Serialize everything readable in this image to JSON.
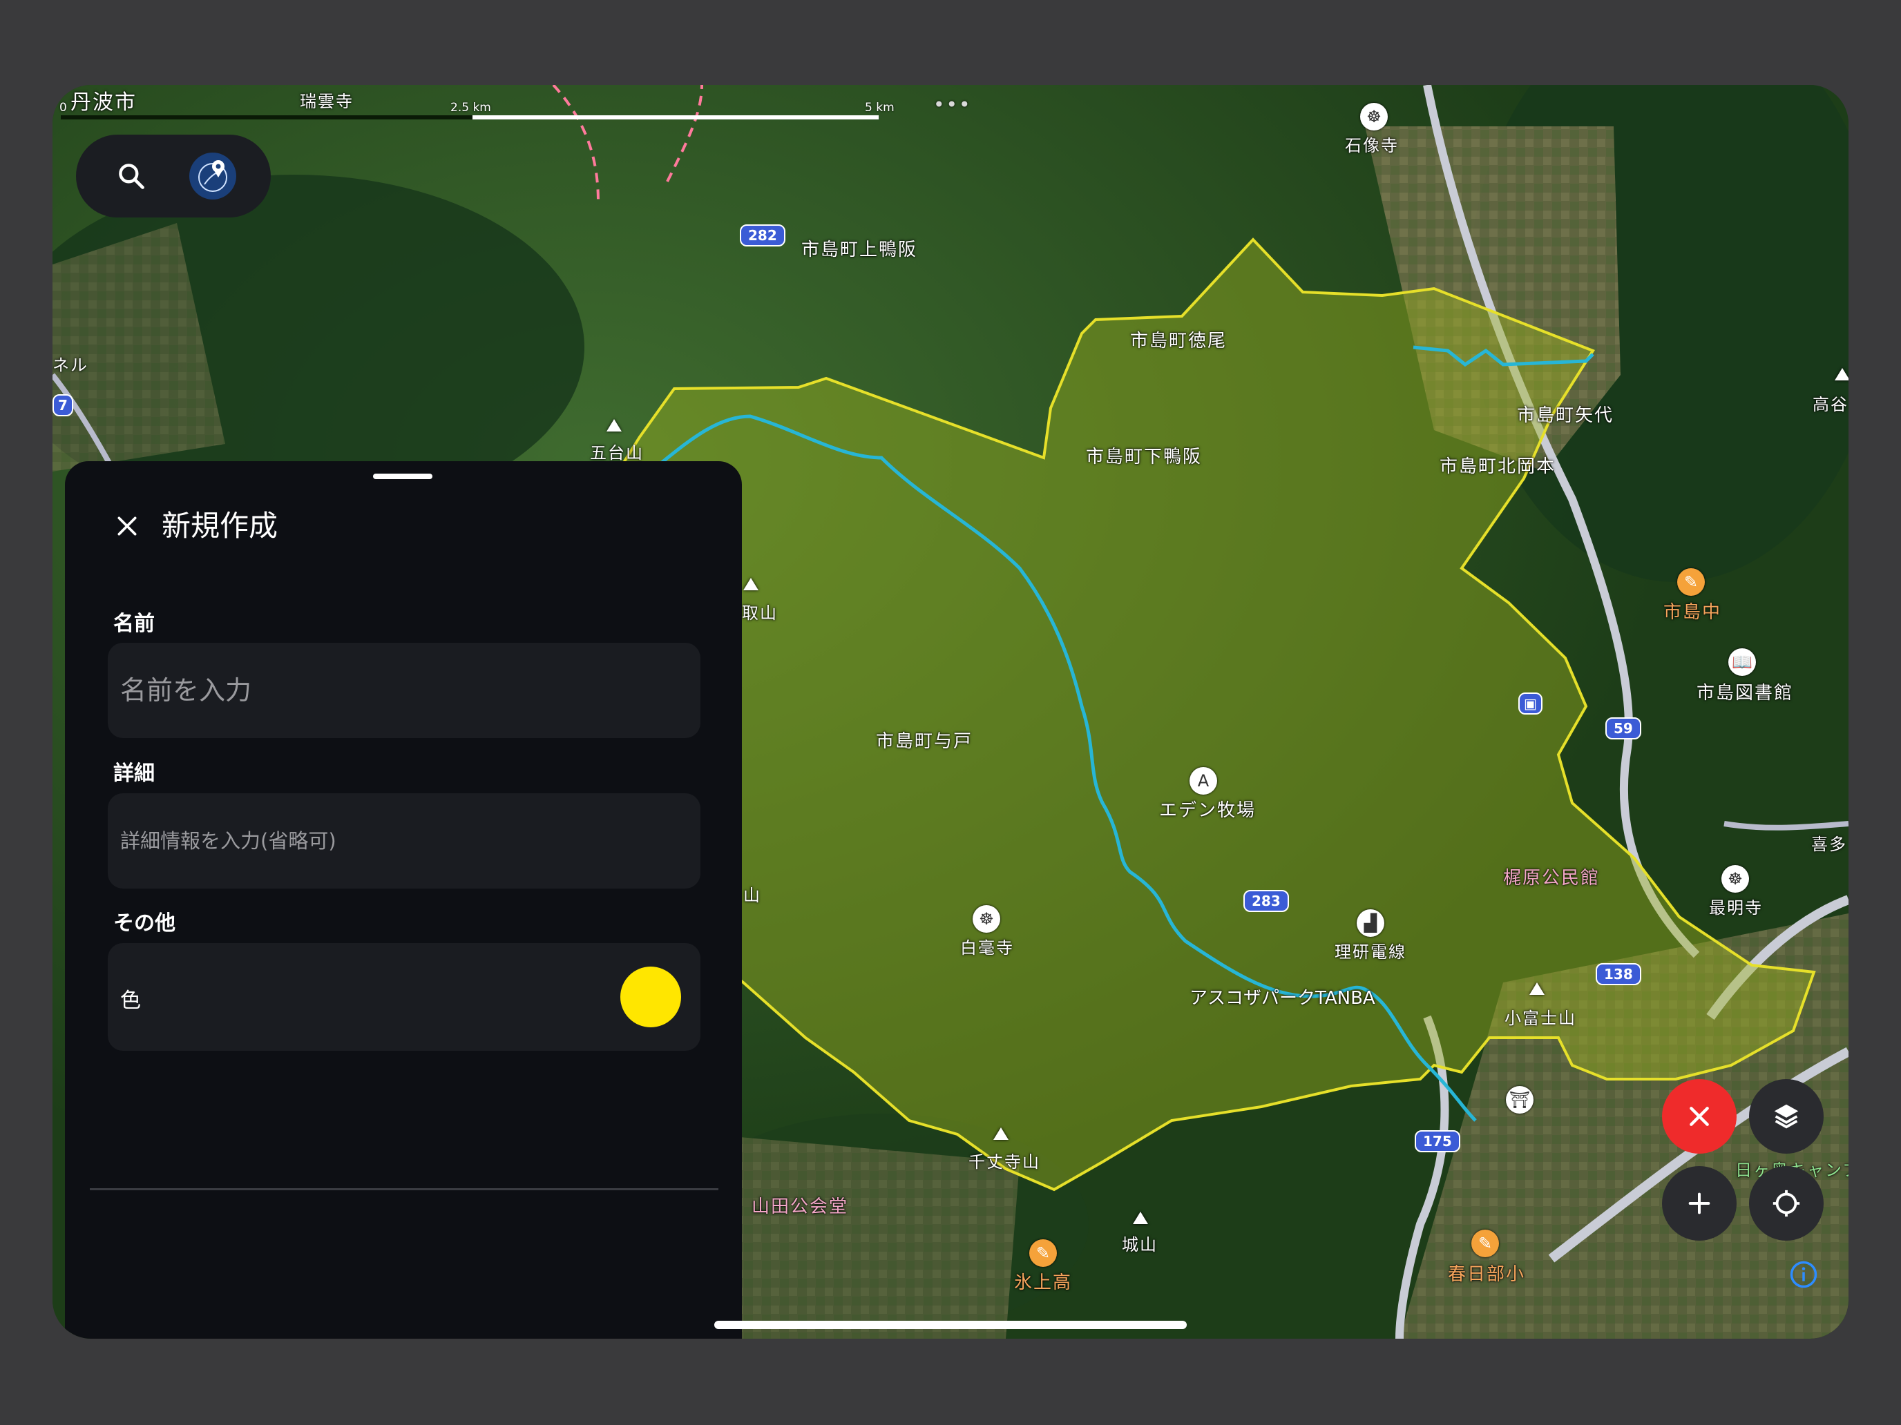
{
  "map": {
    "scale": {
      "start": "0",
      "mid": "2.5 km",
      "end": "5 km",
      "more": "•••"
    },
    "labels": {
      "tamba": "丹波市",
      "zuiunji": "瑞雲寺",
      "sekizoji": "石像寺",
      "kamokamo": "市島町上鴨阪",
      "tokuo": "市島町徳尾",
      "yashiro": "市島町矢代",
      "takaya": "高谷",
      "shimokamo": "市島町下鴨阪",
      "kitaokamoto": "市島町北岡本",
      "godaisan": "五台山",
      "toriyama": "取山",
      "ichijimachu": "市島中",
      "library": "市島図書館",
      "yodo": "市島町与戸",
      "eden": "エデン牧場",
      "kajiwara": "梶原公民館",
      "saimyoji": "最明寺",
      "kita": "喜多",
      "hakugoji": "白毫寺",
      "riken": "理研電線",
      "asuko": "アスコザパークTANBA",
      "kofuji": "小富士山",
      "senjosan": "千丈寺山",
      "yamada": "山田公会堂",
      "jozan": "城山",
      "hikami": "氷上高",
      "kasugabe": "春日部小",
      "hikage": "日ヶ奥キャンプ",
      "left_nru": "ネル",
      "left_san": "山"
    },
    "shields": {
      "r282": "282",
      "r283": "283",
      "r59": "59",
      "r138": "138",
      "r175": "175",
      "r7": "7"
    }
  },
  "panel": {
    "title": "新規作成",
    "name_label": "名前",
    "name_placeholder": "名前を入力",
    "detail_label": "詳細",
    "detail_placeholder": "詳細情報を入力(省略可)",
    "other_label": "その他",
    "color_label": "色",
    "color_value": "#ffe600"
  },
  "colors": {
    "cancel_fab": "#ef2b2b",
    "polygon_stroke": "#e6e02a",
    "river": "#27b6d6"
  }
}
